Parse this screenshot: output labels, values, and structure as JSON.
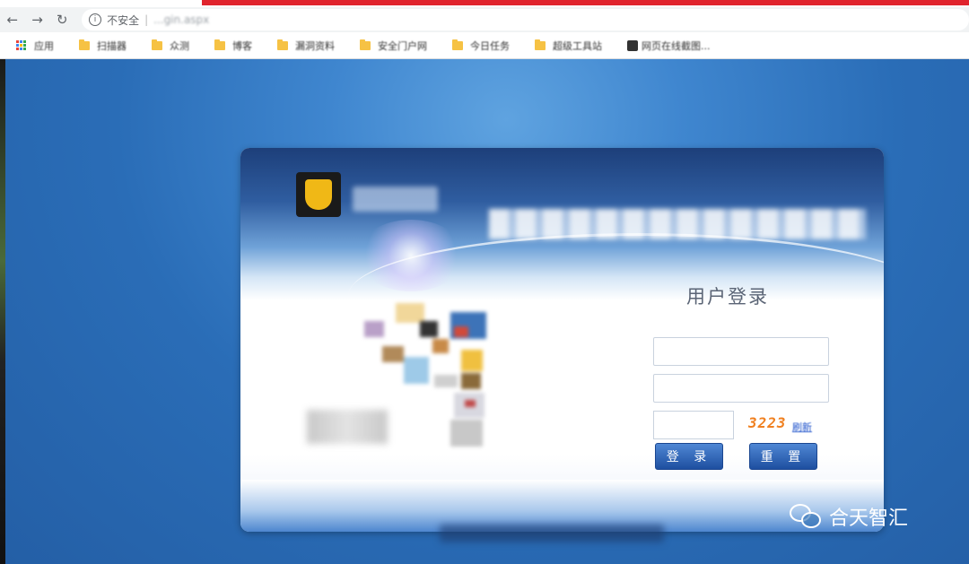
{
  "browser": {
    "security_label": "不安全",
    "url": "...gin.aspx",
    "back_glyph": "←",
    "forward_glyph": "→",
    "reload_glyph": "↻",
    "info_glyph": "i"
  },
  "bookmarks": [
    {
      "label": "应用",
      "icon": "apps-grid-icon"
    },
    {
      "label": "扫描器",
      "icon": "folder-icon"
    },
    {
      "label": "众测",
      "icon": "folder-icon"
    },
    {
      "label": "博客",
      "icon": "folder-icon"
    },
    {
      "label": "漏洞资料",
      "icon": "folder-icon"
    },
    {
      "label": "安全门户网",
      "icon": "folder-icon"
    },
    {
      "label": "今日任务",
      "icon": "folder-icon"
    },
    {
      "label": "超级工具站",
      "icon": "folder-icon"
    },
    {
      "label": "网页在线截图...",
      "icon": "page-icon"
    }
  ],
  "login": {
    "title": "用户登录",
    "username_value": "",
    "password_value": "",
    "captcha_value": "",
    "captcha_code": "3223",
    "captcha_refresh_label": "刷新",
    "login_button": "登 录",
    "reset_button": "重 置"
  },
  "watermark": {
    "text": "合天智汇"
  },
  "colors": {
    "browser_accent": "#e0242d",
    "page_background": "#2b6cb0",
    "button_blue": "#1e4fa0",
    "captcha_orange": "#f08020",
    "logo_gold": "#f0b816"
  }
}
